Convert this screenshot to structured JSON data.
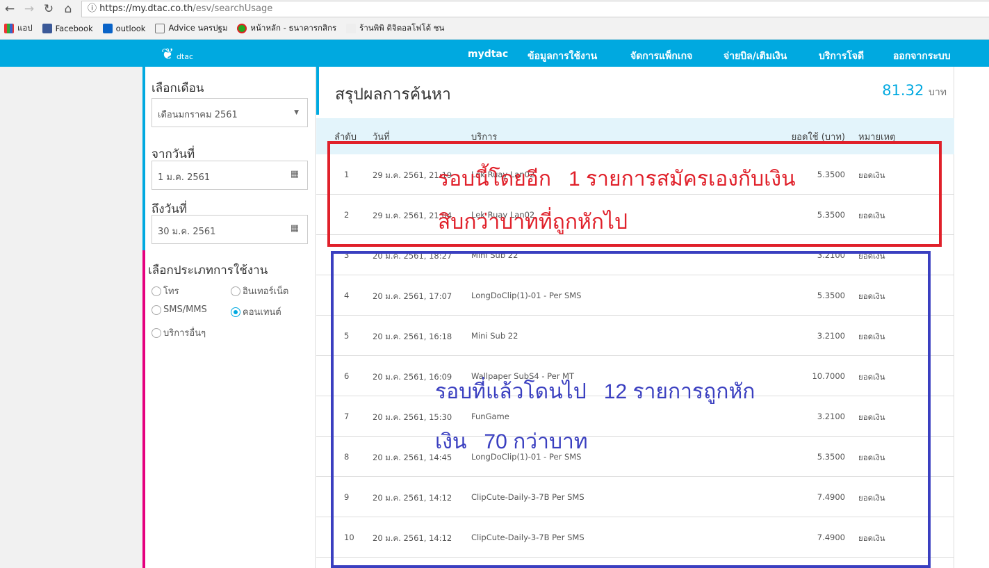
{
  "browser": {
    "url_host": "https://my.dtac.co.th",
    "url_path": "/esv/searchUsage",
    "bookmarks": [
      "แอป",
      "Facebook",
      "outlook",
      "Advice นครปฐม",
      "หน้าหลัก - ธนาคารกสิกร",
      "ร้านพิพิ ดิจิตอลโฟโต้ ชน"
    ]
  },
  "nav": {
    "logo": "dtac",
    "items": [
      "mydtac",
      "ข้อมูลการใช้งาน",
      "จัดการแพ็กเกจ",
      "จ่ายบิล/เติมเงิน",
      "บริการโจดี",
      "ออกจากระบบ"
    ]
  },
  "sidebar": {
    "month_label": "เลือกเดือน",
    "month_value": "เดือนมกราคม 2561",
    "from_label": "จากวันที่",
    "from_value": "1 ม.ค. 2561",
    "to_label": "ถึงวันที่",
    "to_value": "30 ม.ค. 2561",
    "type_label": "เลือกประเภทการใช้งาน",
    "types": [
      "โทร",
      "อินเทอร์เน็ต",
      "SMS/MMS",
      "คอนเทนต์",
      "บริการอื่นๆ"
    ],
    "selected_type": "คอนเทนต์"
  },
  "main": {
    "title": "สรุปผลการค้นหา",
    "total": "81.32",
    "currency": "บาท",
    "headers": [
      "ลำดับ",
      "วันที่",
      "บริการ",
      "ยอดใช้ (บาท)",
      "หมายเหตุ"
    ],
    "rows": [
      [
        "1",
        "29 ม.ค. 2561, 21:19",
        "Lek Ruay Lan02",
        "5.3500",
        "ยอดเงิน"
      ],
      [
        "2",
        "29 ม.ค. 2561, 21:04",
        "Lek Ruay Lan02",
        "5.3500",
        "ยอดเงิน"
      ],
      [
        "3",
        "20 ม.ค. 2561, 18:27",
        "Mini Sub 22",
        "3.2100",
        "ยอดเงิน"
      ],
      [
        "4",
        "20 ม.ค. 2561, 17:07",
        "LongDoClip(1)-01 - Per SMS",
        "5.3500",
        "ยอดเงิน"
      ],
      [
        "5",
        "20 ม.ค. 2561, 16:18",
        "Mini Sub 22",
        "3.2100",
        "ยอดเงิน"
      ],
      [
        "6",
        "20 ม.ค. 2561, 16:09",
        "Wallpaper SubS4 - Per MT",
        "10.7000",
        "ยอดเงิน"
      ],
      [
        "7",
        "20 ม.ค. 2561, 15:30",
        "FunGame",
        "3.2100",
        "ยอดเงิน"
      ],
      [
        "8",
        "20 ม.ค. 2561, 14:45",
        "LongDoClip(1)-01 - Per SMS",
        "5.3500",
        "ยอดเงิน"
      ],
      [
        "9",
        "20 ม.ค. 2561, 14:12",
        "ClipCute-Daily-3-7B Per SMS",
        "7.4900",
        "ยอดเงิน"
      ],
      [
        "10",
        "20 ม.ค. 2561, 14:12",
        "ClipCute-Daily-3-7B Per SMS",
        "7.4900",
        "ยอดเงิน"
      ]
    ]
  },
  "annotations": {
    "red_line1": "รอบนี้โดยอีก   1 รายการสมัครเองกับเงิน",
    "red_line2": "สิบกว่าบาทที่ถูกหักไป",
    "blue_line1": "รอบที่แล้วโดนไป   12 รายการถูกหัก",
    "blue_line2": "เงิน   70 กว่าบาท",
    "red": "#e0202a",
    "blue": "#3a3fc0"
  }
}
